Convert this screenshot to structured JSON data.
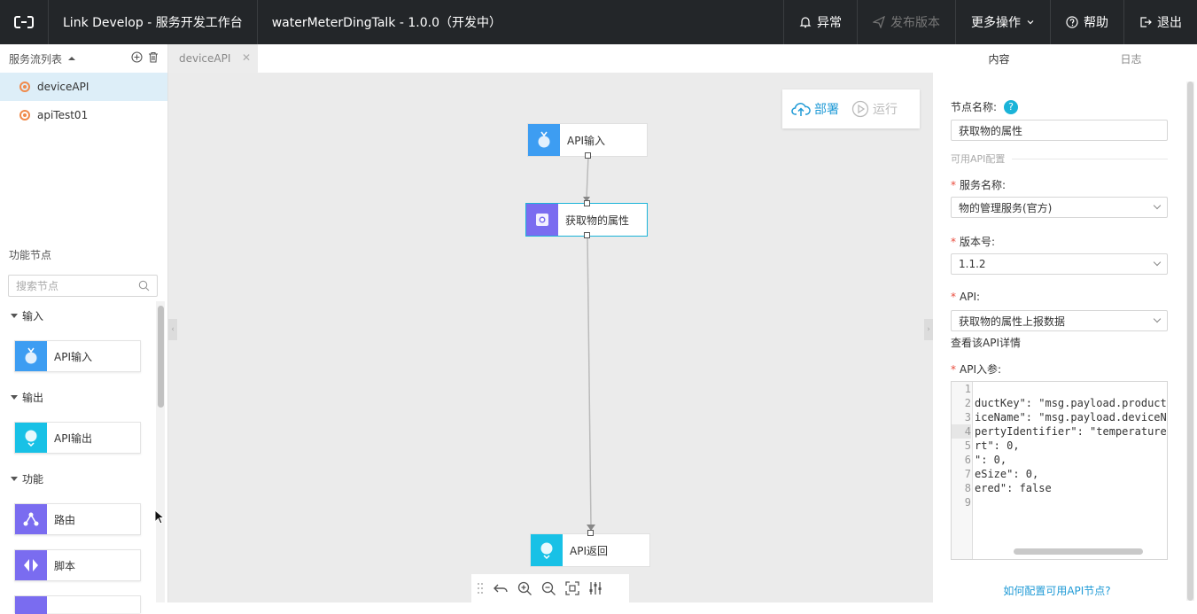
{
  "topbar": {
    "app_title": "Link Develop - 服务开发工作台",
    "project_title": "waterMeterDingTalk - 1.0.0（开发中）",
    "actions": [
      {
        "label": "异常",
        "icon": "bell-icon",
        "disabled": false
      },
      {
        "label": "发布版本",
        "icon": "send-icon",
        "disabled": true
      },
      {
        "label": "更多操作",
        "icon": "chevron-down-icon",
        "disabled": false
      },
      {
        "label": "帮助",
        "icon": "help-icon",
        "disabled": false
      },
      {
        "label": "退出",
        "icon": "logout-icon",
        "disabled": false
      }
    ]
  },
  "left": {
    "flow_list_title": "服务流列表",
    "flows": [
      {
        "label": "deviceAPI",
        "active": true
      },
      {
        "label": "apiTest01",
        "active": false
      }
    ],
    "function_nodes_title": "功能节点",
    "search_placeholder": "搜索节点",
    "categories": [
      {
        "label": "输入",
        "nodes": [
          {
            "label": "API输入",
            "icon": "api-input-icon",
            "color": "#3d9df2"
          }
        ]
      },
      {
        "label": "输出",
        "nodes": [
          {
            "label": "API输出",
            "icon": "api-output-icon",
            "color": "#18c1e6"
          }
        ]
      },
      {
        "label": "功能",
        "nodes": [
          {
            "label": "路由",
            "icon": "router-icon",
            "color": "#7a6cf0"
          },
          {
            "label": "脚本",
            "icon": "script-icon",
            "color": "#7a6cf0"
          }
        ]
      }
    ]
  },
  "tabs": [
    {
      "label": "deviceAPI"
    }
  ],
  "canvas": {
    "deploy_label": "部署",
    "run_label": "运行",
    "nodes": [
      {
        "label": "API输入",
        "icon": "api-input-icon",
        "color": "#3d9df2"
      },
      {
        "label": "获取物的属性",
        "icon": "device-property-icon",
        "color": "#7a6cf0",
        "selected": true
      },
      {
        "label": "API返回",
        "icon": "api-return-icon",
        "color": "#18c1e6"
      }
    ]
  },
  "right": {
    "tabs": [
      {
        "label": "内容",
        "active": true
      },
      {
        "label": "日志",
        "active": false
      }
    ],
    "node_name_label": "节点名称:",
    "node_name_value": "获取物的属性",
    "section_title": "可用API配置",
    "service_label": "服务名称:",
    "service_value": "物的管理服务(官方)",
    "version_label": "版本号:",
    "version_value": "1.1.2",
    "api_label": "API:",
    "api_value": "获取物的属性上报数据",
    "api_detail_link": "查看该API详情",
    "params_label": "API入参:",
    "code_lines": [
      "",
      "ductKey\": \"msg.payload.productK",
      "iceName\": \"msg.payload.deviceNa",
      "pertyIdentifier\": \"temperature\"",
      "rt\": 0,",
      "\": 0,",
      "eSize\": 0,",
      "ered\": false",
      ""
    ],
    "line_numbers": [
      "1",
      "2",
      "3",
      "4",
      "5",
      "6",
      "7",
      "8",
      "9"
    ],
    "current_line": 4,
    "help_link": "如何配置可用API节点?"
  }
}
